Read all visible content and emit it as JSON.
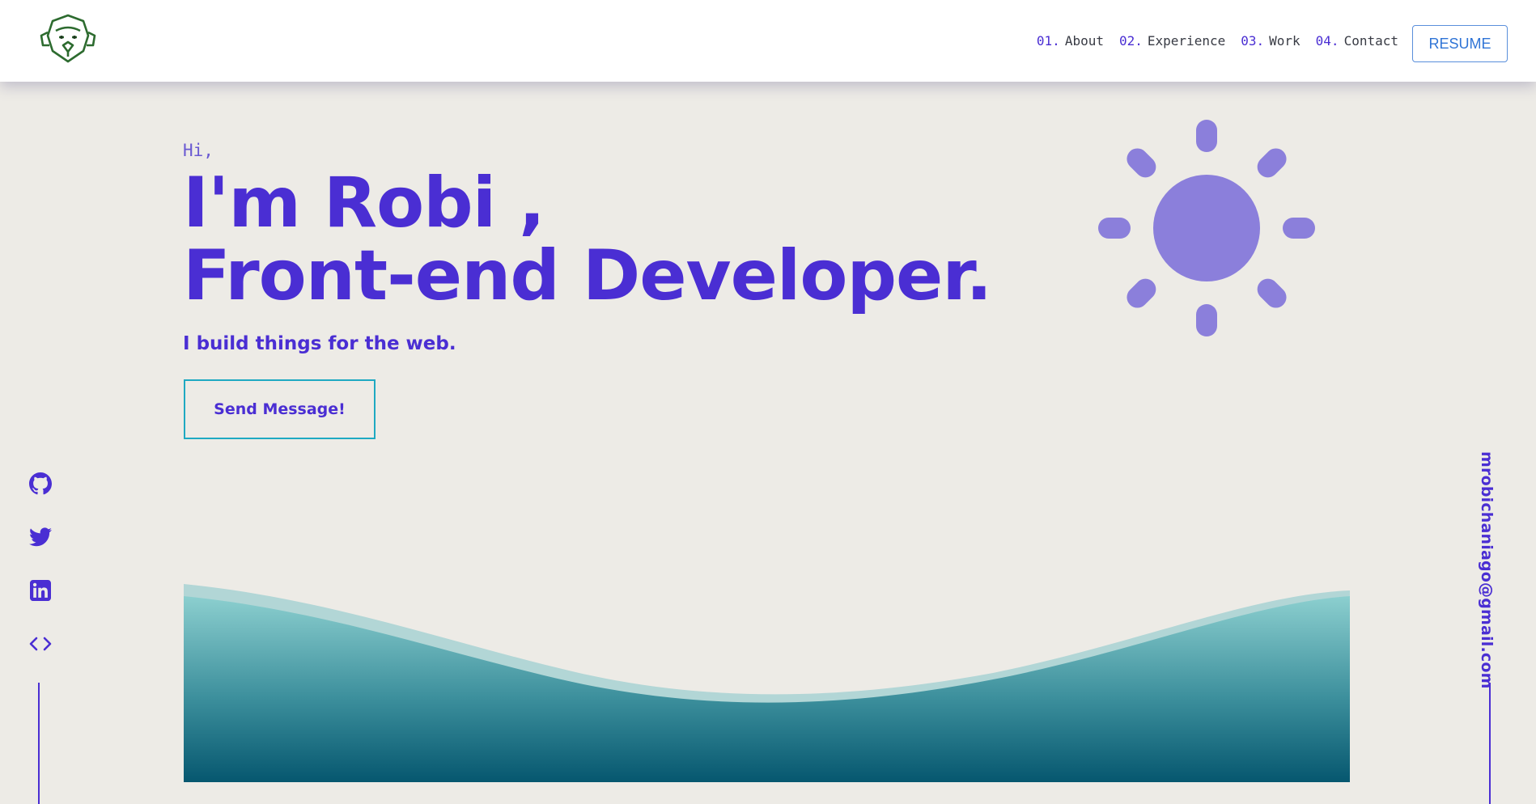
{
  "header": {
    "logo_icon": "lion-head-logo-icon",
    "nav": [
      {
        "num": "01.",
        "label": "About"
      },
      {
        "num": "02.",
        "label": "Experience"
      },
      {
        "num": "03.",
        "label": "Work"
      },
      {
        "num": "04.",
        "label": "Contact"
      }
    ],
    "resume_label": "RESUME"
  },
  "hero": {
    "greeting": "Hi,",
    "title_line1": "I'm Robi ,",
    "title_line2": "Front-end Developer.",
    "tagline": "I build things for the web.",
    "cta_label": "Send Message!",
    "theme_icon": "sun-icon"
  },
  "social": [
    {
      "icon": "github-icon"
    },
    {
      "icon": "twitter-icon"
    },
    {
      "icon": "linkedin-icon"
    },
    {
      "icon": "code-icon"
    }
  ],
  "email": "mrobichaniago@gmail.com",
  "colors": {
    "accent": "#4a2ed3",
    "background": "#edebe6",
    "sun": "#8b7fdb",
    "button_border": "#1fa9c2",
    "resume_border": "#5a8fdb"
  }
}
